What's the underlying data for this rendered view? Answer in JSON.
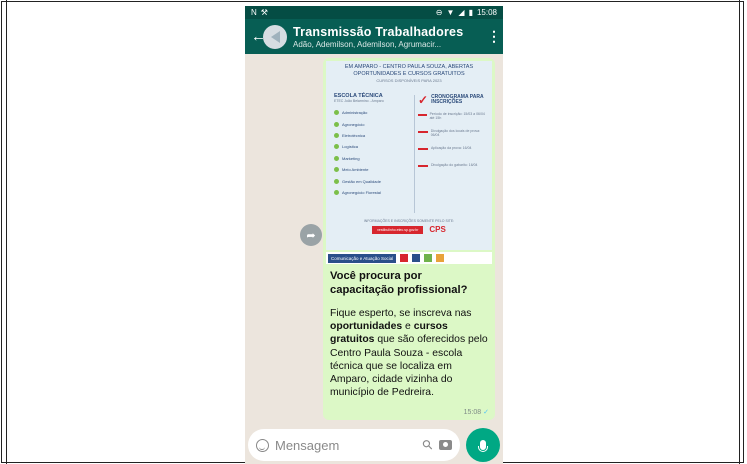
{
  "status_bar": {
    "left_icons": [
      "N",
      "⚒"
    ],
    "time": "15:08"
  },
  "header": {
    "title": "Transmissão Trabalhadores",
    "subtitle": "Adão, Ademilson, Ademilson, Agrumacir..."
  },
  "message": {
    "flyer": {
      "headline": "EM AMPARO - CENTRO PAULA SOUZA, ABERTAS OPORTUNIDADES E CURSOS GRATUITOS",
      "small_note": "CURSOS DISPONÍVEIS PARA 2023",
      "school_title": "ESCOLA TÉCNICA",
      "school_sub": "ETEC João Belarmino - Amparo",
      "courses": [
        "Administração",
        "Agronegócio",
        "Eletrotécnica",
        "Logística",
        "Marketing",
        "Meio Ambiente",
        "Gestão em Qualidade",
        "Agronegócio Florestal"
      ],
      "schedule_title": "CRONOGRAMA PARA INSCRIÇÕES",
      "schedule_items": [
        "Período de inscrição: 15/03 a 06/04 até 15h",
        "Divulgação dos locais de prova: 06/04",
        "Aplicação da prova: 16/04",
        "Divulgação do gabarito: 16/04"
      ],
      "footer_note": "INFORMAÇÕES E INSCRIÇÕES SOMENTE PELO SITE:",
      "site_label": "vestibulinho.etec.sp.gov.br",
      "logo_text": "CPS"
    },
    "banner_label": "Comunicação e Atuação Social",
    "heading": "Você procura por capacitação profissional?",
    "body_html_parts": {
      "p1": "Fique esperto, se inscreva nas ",
      "b1": "oportunidades",
      "p2": " e ",
      "b2": "cursos gratuitos",
      "p3": " que são oferecidos pelo Centro Paula Souza - escola técnica que se localiza em Amparo, cidade vizinha do município de Pedreira."
    },
    "time": "15:08",
    "ticks": "✓"
  },
  "composer": {
    "placeholder": "Mensagem"
  },
  "colors": {
    "app_bar": "#075e54",
    "bubble": "#dcf8c6",
    "mic_button": "#00a884"
  }
}
